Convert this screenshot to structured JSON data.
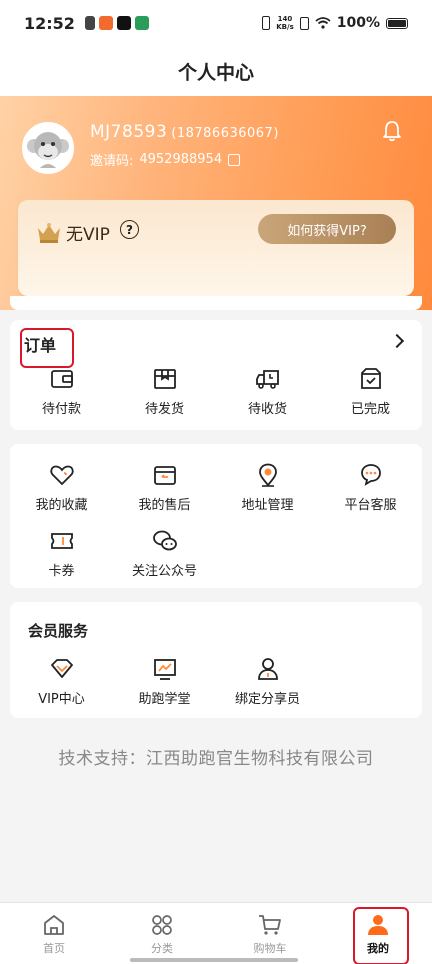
{
  "status_bar": {
    "time": "12:52",
    "speed_top": "140",
    "speed_bottom": "KB/s",
    "battery": "100%"
  },
  "header": {
    "title": "个人中心"
  },
  "profile": {
    "username": "MJ78593",
    "phone": "(18786636067)",
    "invite_label": "邀请码:",
    "invite_code": "4952988954"
  },
  "vip": {
    "status": "无VIP",
    "help_mark": "?",
    "cta": "如何获得VIP?"
  },
  "orders": {
    "title": "订单",
    "items": [
      {
        "label": "待付款",
        "icon": "wallet-icon"
      },
      {
        "label": "待发货",
        "icon": "box-icon"
      },
      {
        "label": "待收货",
        "icon": "truck-icon"
      },
      {
        "label": "已完成",
        "icon": "check-box-icon"
      }
    ]
  },
  "tools": {
    "items": [
      {
        "label": "我的收藏",
        "icon": "heart-icon"
      },
      {
        "label": "我的售后",
        "icon": "return-box-icon"
      },
      {
        "label": "地址管理",
        "icon": "location-pin-icon"
      },
      {
        "label": "平台客服",
        "icon": "chat-bubble-icon"
      },
      {
        "label": "卡券",
        "icon": "ticket-icon"
      },
      {
        "label": "关注公众号",
        "icon": "wechat-icon"
      }
    ]
  },
  "member": {
    "title": "会员服务",
    "items": [
      {
        "label": "VIP中心",
        "icon": "diamond-icon"
      },
      {
        "label": "助跑学堂",
        "icon": "chart-board-icon"
      },
      {
        "label": "绑定分享员",
        "icon": "person-icon"
      }
    ]
  },
  "support": "技术支持：江西助跑官生物科技有限公司",
  "tabbar": {
    "items": [
      {
        "label": "首页",
        "icon": "home-icon",
        "active": false
      },
      {
        "label": "分类",
        "icon": "category-icon",
        "active": false
      },
      {
        "label": "购物车",
        "icon": "cart-icon",
        "active": false
      },
      {
        "label": "我的",
        "icon": "user-icon",
        "active": true
      }
    ]
  },
  "colors": {
    "accent": "#ff8a3d",
    "highlight": "#d9182b",
    "vip_gold": "#b48a5e"
  }
}
